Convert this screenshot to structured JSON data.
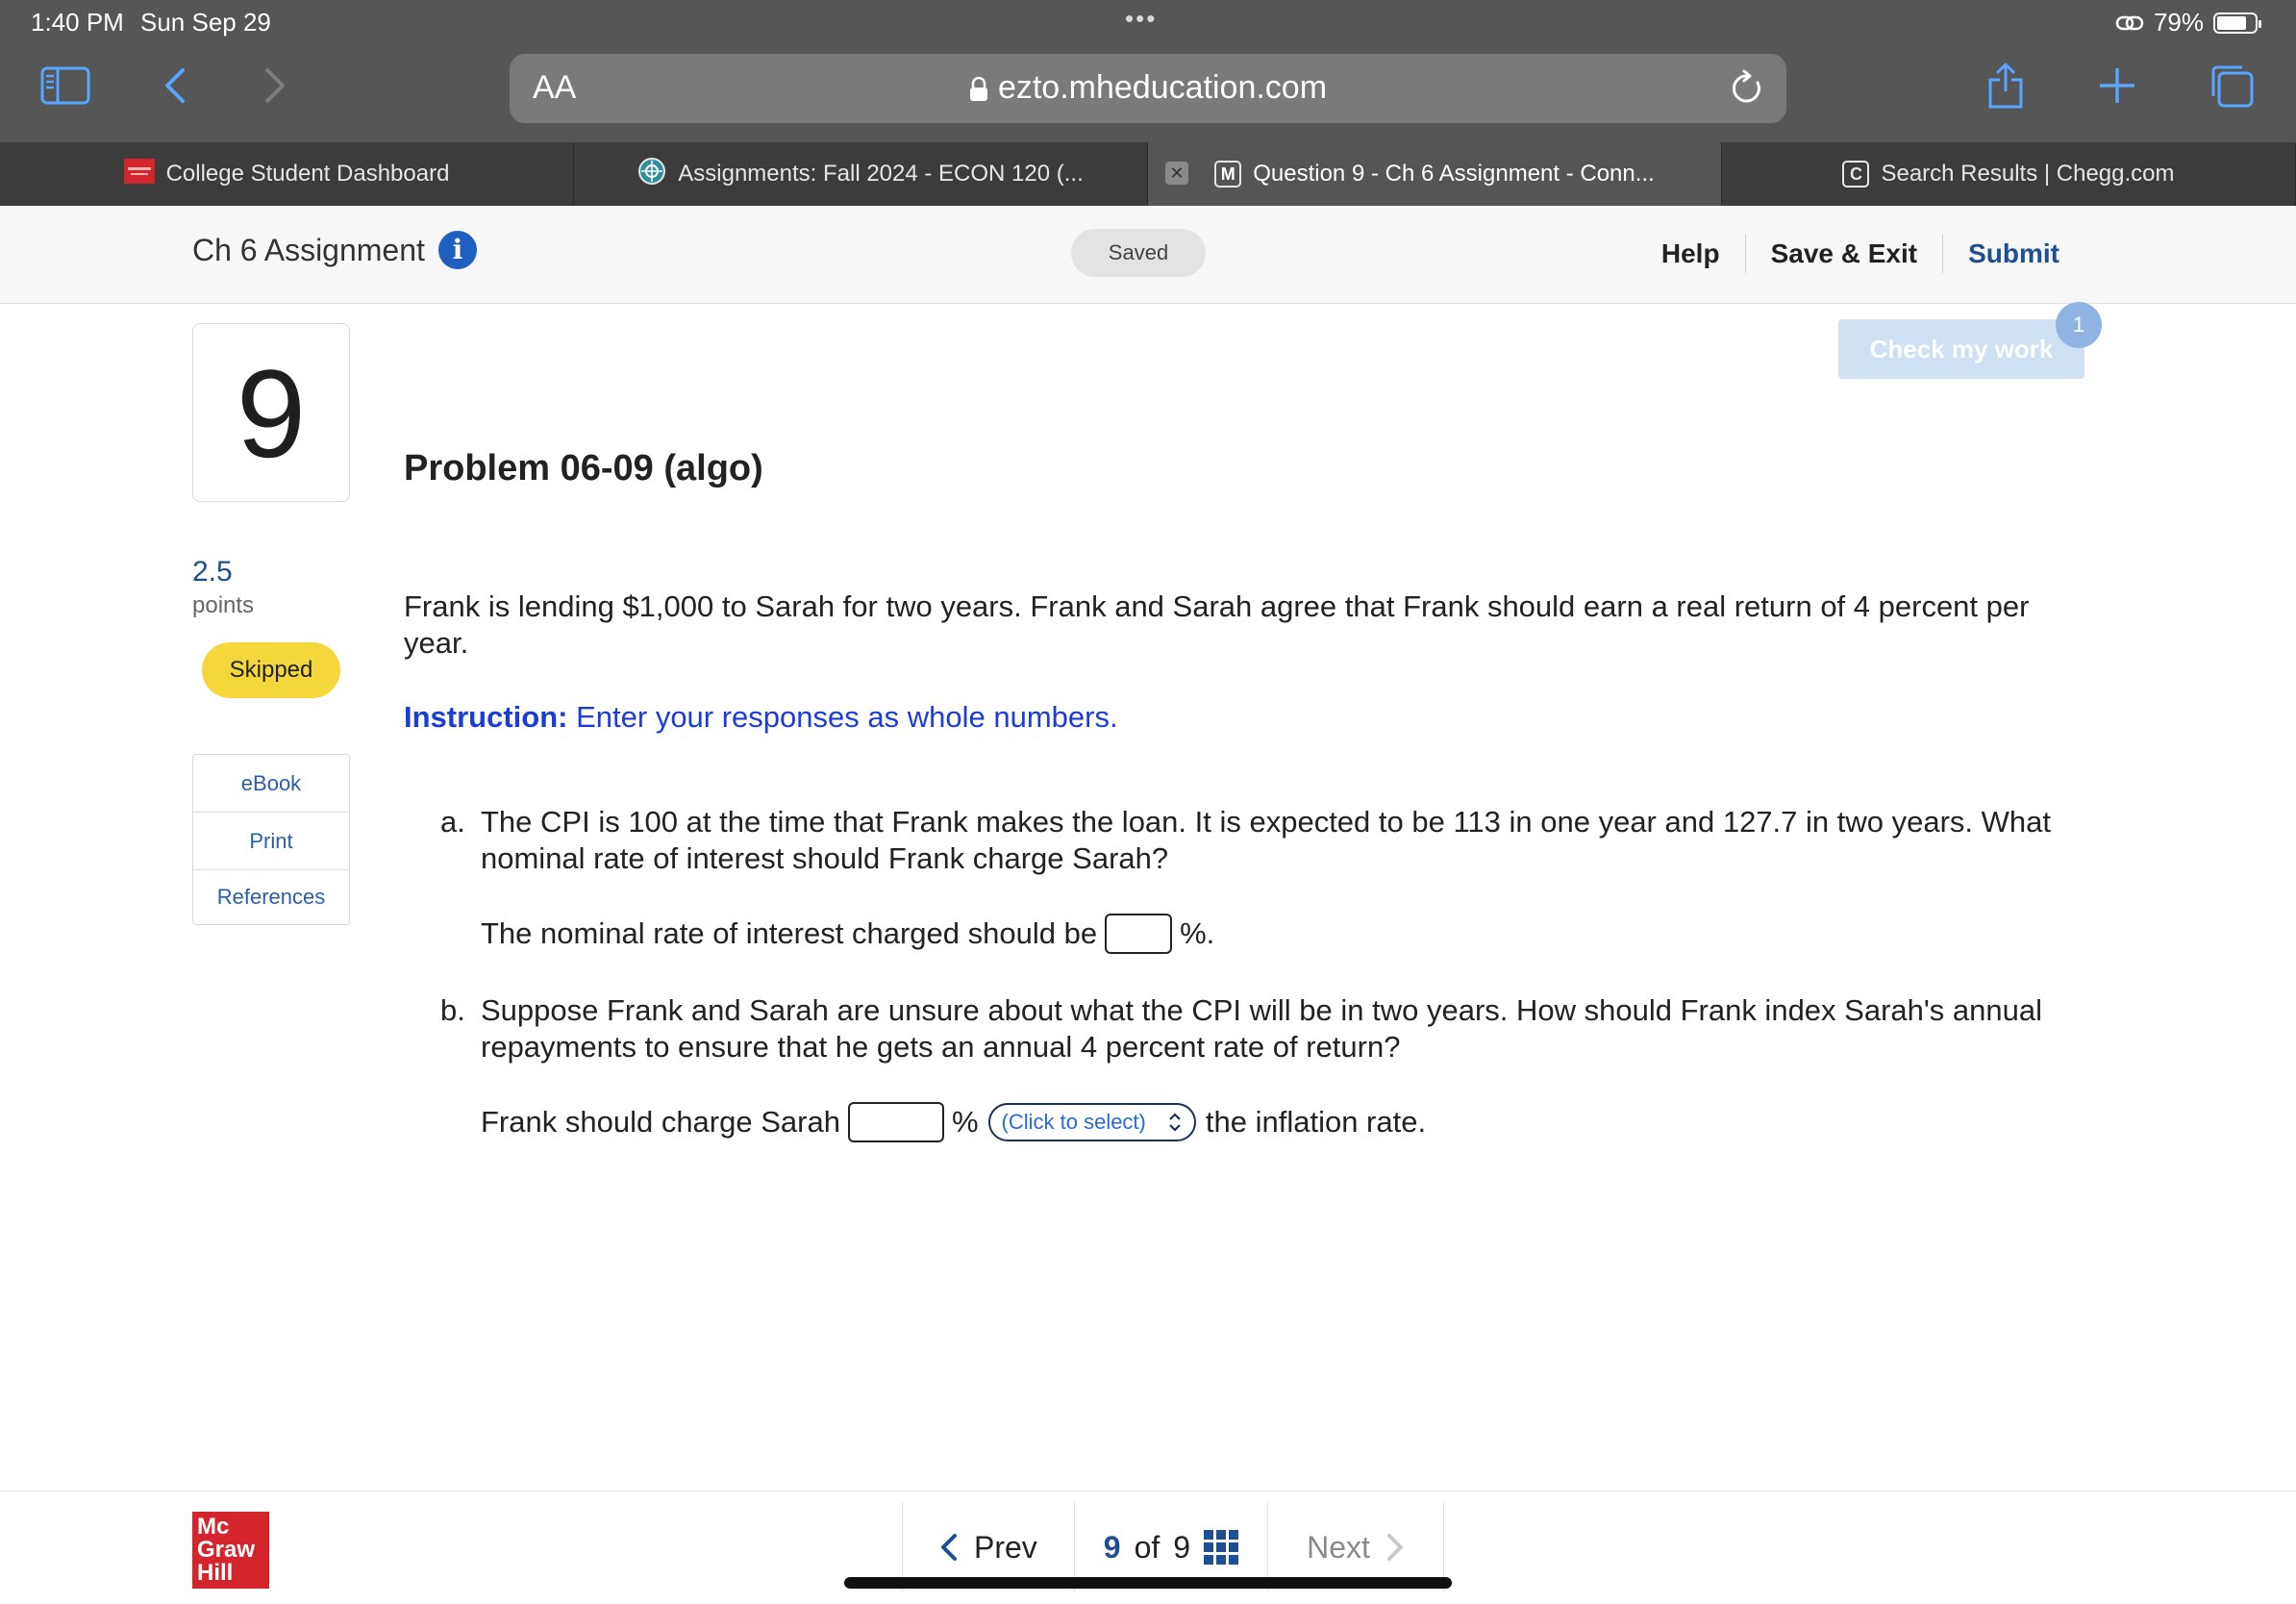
{
  "status_bar": {
    "time": "1:40 PM",
    "date": "Sun Sep 29",
    "battery": "79%",
    "battery_level": 0.79
  },
  "browser": {
    "aa_label": "AA",
    "url": "ezto.mheducation.com",
    "tabs": [
      {
        "label": "College Student Dashboard"
      },
      {
        "label": "Assignments: Fall 2024 - ECON 120 (..."
      },
      {
        "label": "Question 9 - Ch 6 Assignment - Conn...",
        "favicon": "M",
        "active": true
      },
      {
        "label": "Search Results | Chegg.com",
        "favicon": "C"
      }
    ]
  },
  "header": {
    "title": "Ch 6 Assignment",
    "saved": "Saved",
    "help": "Help",
    "save_exit": "Save & Exit",
    "submit": "Submit"
  },
  "sidebar": {
    "question_number": "9",
    "points_value": "2.5",
    "points_label": "points",
    "status": "Skipped",
    "resources": [
      "eBook",
      "Print",
      "References"
    ]
  },
  "question": {
    "check_work": "Check my work",
    "check_badge": "1",
    "title": "Problem 06-09 (algo)",
    "text": "Frank is lending $1,000 to Sarah for two years. Frank and Sarah agree that Frank should earn a real return of 4 percent per year.",
    "instruction_label": "Instruction:",
    "instruction_text": " Enter your responses as whole numbers.",
    "part_a": {
      "letter": "a.",
      "text": "The CPI is 100 at the time that Frank makes the loan. It is expected to be 113 in one year and 127.7 in two years. What nominal rate of interest should Frank charge Sarah?",
      "answer_prefix": "The nominal rate of interest charged should be",
      "answer_suffix": "%."
    },
    "part_b": {
      "letter": "b.",
      "text": "Suppose Frank and Sarah are unsure about what the CPI will be in two years. How should Frank index Sarah's annual repayments to ensure that he gets an annual 4 percent rate of return?",
      "answer_prefix": "Frank should charge Sarah",
      "percent": "%",
      "select_placeholder": "(Click to select)",
      "answer_suffix": "the inflation rate."
    }
  },
  "footer": {
    "logo_lines": [
      "Mc",
      "Graw",
      "Hill"
    ],
    "prev": "Prev",
    "current": "9",
    "of": "of",
    "total": "9",
    "next": "Next"
  }
}
